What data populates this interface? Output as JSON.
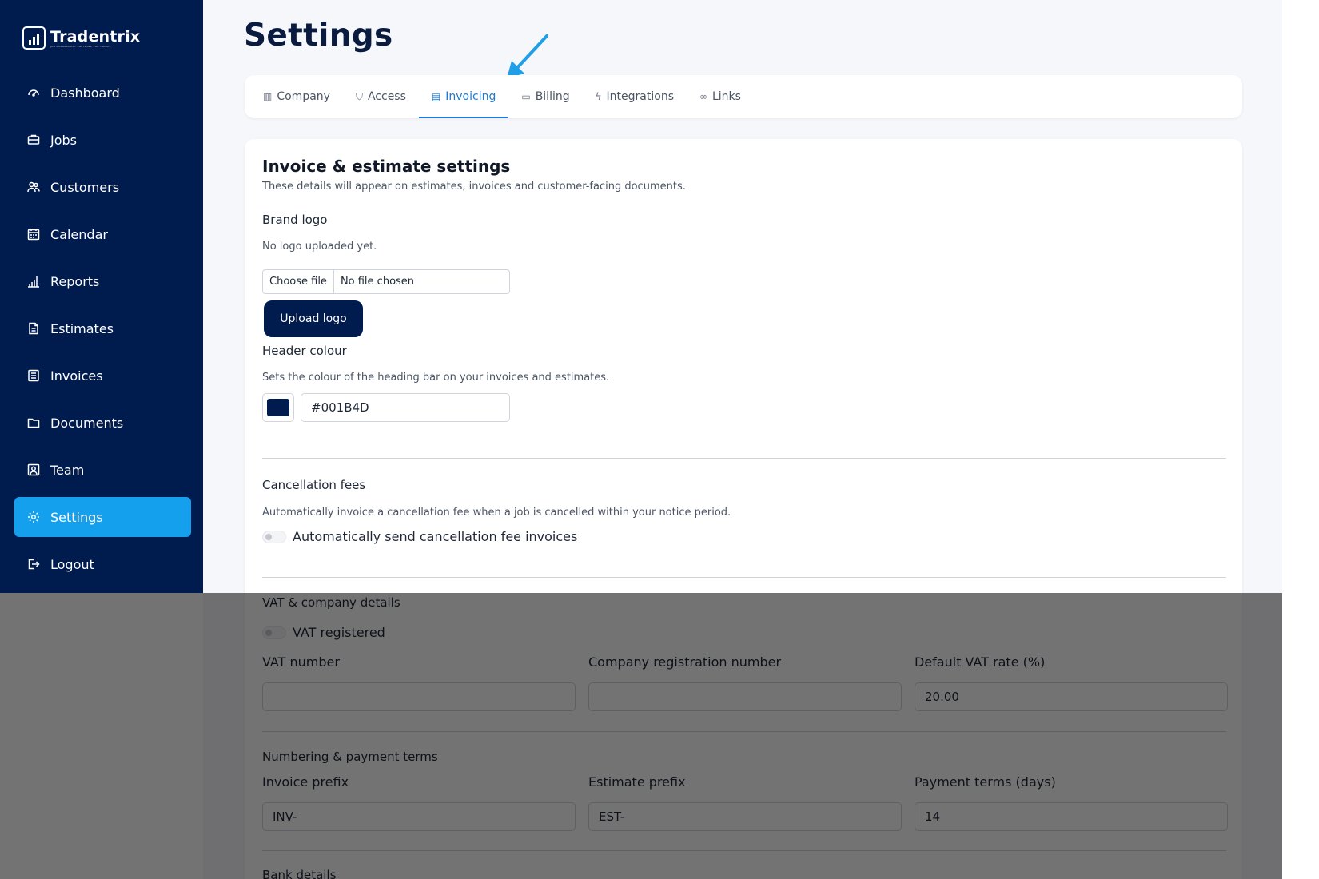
{
  "brand": {
    "name": "Tradentrix",
    "tagline": "JOB MANAGEMENT SOFTWARE FOR TRADES"
  },
  "sidebar": {
    "items": [
      {
        "label": "Dashboard",
        "icon": "dashboard-icon"
      },
      {
        "label": "Jobs",
        "icon": "briefcase-icon"
      },
      {
        "label": "Customers",
        "icon": "users-icon"
      },
      {
        "label": "Calendar",
        "icon": "calendar-icon"
      },
      {
        "label": "Reports",
        "icon": "bar-chart-icon"
      },
      {
        "label": "Estimates",
        "icon": "file-icon"
      },
      {
        "label": "Invoices",
        "icon": "invoice-icon"
      },
      {
        "label": "Documents",
        "icon": "folder-icon"
      },
      {
        "label": "Team",
        "icon": "team-icon"
      },
      {
        "label": "Settings",
        "icon": "gear-icon",
        "active": true
      },
      {
        "label": "Logout",
        "icon": "logout-icon"
      }
    ]
  },
  "page": {
    "title": "Settings"
  },
  "tabs": [
    {
      "label": "Company",
      "icon": "building-icon"
    },
    {
      "label": "Access",
      "icon": "shield-icon"
    },
    {
      "label": "Invoicing",
      "icon": "invoice-icon",
      "active": true
    },
    {
      "label": "Billing",
      "icon": "card-icon"
    },
    {
      "label": "Integrations",
      "icon": "plug-icon"
    },
    {
      "label": "Links",
      "icon": "link-icon"
    }
  ],
  "invoice_settings": {
    "title": "Invoice & estimate settings",
    "subtitle": "These details will appear on estimates, invoices and customer-facing documents.",
    "brand_logo": {
      "label": "Brand logo",
      "status": "No logo uploaded yet.",
      "choose_file": "Choose file",
      "file_status": "No file chosen",
      "upload_label": "Upload logo"
    },
    "header_colour": {
      "label": "Header colour",
      "description": "Sets the colour of the heading bar on your invoices and estimates.",
      "value": "#001B4D"
    },
    "cancellation": {
      "label": "Cancellation fees",
      "description": "Automatically invoice a cancellation fee when a job is cancelled within your notice period.",
      "toggle_label": "Automatically send cancellation fee invoices",
      "enabled": false
    },
    "vat": {
      "label": "VAT & company details",
      "toggle_label": "VAT registered",
      "enabled": false,
      "vat_number_label": "VAT number",
      "vat_number_value": "",
      "company_reg_label": "Company registration number",
      "company_reg_value": "",
      "default_rate_label": "Default VAT rate (%)",
      "default_rate_value": "20.00"
    },
    "numbering": {
      "label": "Numbering & payment terms",
      "invoice_prefix_label": "Invoice prefix",
      "invoice_prefix_value": "INV-",
      "estimate_prefix_label": "Estimate prefix",
      "estimate_prefix_value": "EST-",
      "payment_terms_label": "Payment terms (days)",
      "payment_terms_value": "14"
    },
    "bank": {
      "label": "Bank details"
    }
  },
  "colors": {
    "sidebar_bg": "#001b4d",
    "accent": "#15a0ee",
    "tab_active": "#1b7bd6",
    "header_colour_swatch": "#001b4d"
  }
}
